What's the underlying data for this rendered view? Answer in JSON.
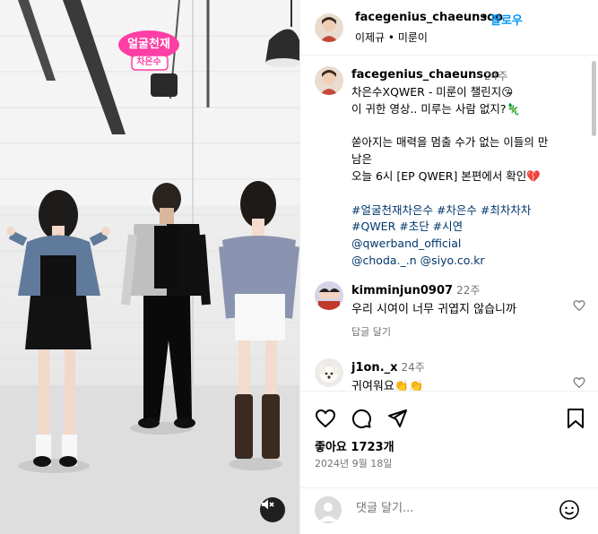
{
  "header": {
    "username": "facegenius_chaeunsoo",
    "separator": "•",
    "follow_label": "팔로우",
    "subtitle": "이제규 • 미룬이"
  },
  "caption": {
    "username": "facegenius_chaeunsoo",
    "time": "24주",
    "lines": [
      "차은수XQWER - 미룬이 챌린지😘",
      "이 귀한 영상.. 미루는 사람 없지?🦎",
      "",
      "쏟아지는 매력을 멈출 수가 없는 이들의 만",
      "남은",
      "오늘 6시 [EP QWER] 본편에서 확인💔",
      "",
      "#얼굴천재차은수 #차은수 #최차차차",
      "#QWER #초단 #시연",
      "@qwerband_official",
      "@choda._.n @siyo.co.kr"
    ]
  },
  "comments": [
    {
      "username": "kimminjun0907",
      "time": "22주",
      "text": "우리 시여이 너무 귀엽지 않습니까",
      "reply_label": "답글 달기"
    },
    {
      "username": "j1on._x",
      "time": "24주",
      "text": "귀여워요👏👏"
    }
  ],
  "video": {
    "badge_top": "얼굴천재",
    "badge_bottom": "차은수",
    "mute_icon": "muted-speaker-icon"
  },
  "actions": {
    "icons": [
      "heart-icon",
      "comment-icon",
      "share-icon",
      "bookmark-icon"
    ],
    "likes": "좋아요 1723개",
    "date": "2024년 9월 18일"
  },
  "comment_box": {
    "placeholder": "댓글 달기...",
    "emoji_icon": "smiley-icon"
  },
  "colors": {
    "accent": "#0095f6",
    "secondary_text": "#737373",
    "hashtag": "#00376b",
    "border": "#efefef"
  }
}
